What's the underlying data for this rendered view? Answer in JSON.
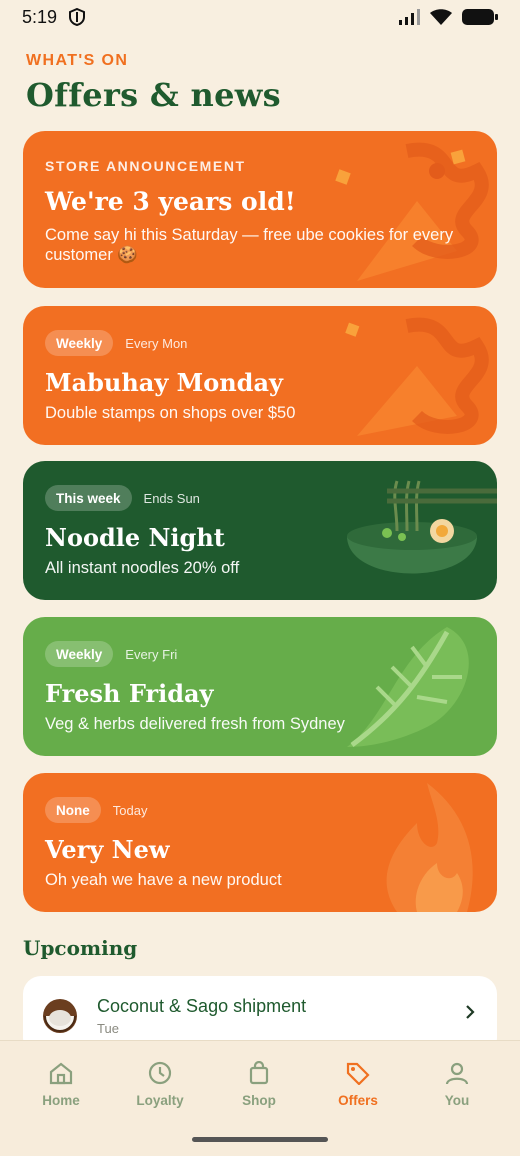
{
  "status": {
    "time": "5:19"
  },
  "header": {
    "eyebrow": "WHAT'S ON",
    "title": "Offers & news"
  },
  "announcement": {
    "kicker": "STORE ANNOUNCEMENT",
    "title": "We're 3 years old!",
    "desc": "Come say hi this Saturday — free ube cookies for every customer 🍪"
  },
  "offers": [
    {
      "badge": "Weekly",
      "meta": "Every Mon",
      "title": "Mabuhay Monday",
      "desc": "Double stamps on shops over $50"
    },
    {
      "badge": "This week",
      "meta": "Ends Sun",
      "title": "Noodle Night",
      "desc": "All instant noodles 20% off"
    },
    {
      "badge": "Weekly",
      "meta": "Every Fri",
      "title": "Fresh Friday",
      "desc": "Veg & herbs delivered fresh from Sydney"
    },
    {
      "badge": "None",
      "meta": "Today",
      "title": "Very New",
      "desc": "Oh yeah we have a new product"
    }
  ],
  "upcoming": {
    "section_title": "Upcoming",
    "items": [
      {
        "title": "Coconut & Sago shipment",
        "sub": "Tue"
      }
    ]
  },
  "nav": {
    "items": [
      {
        "label": "Home",
        "icon": "home-icon"
      },
      {
        "label": "Loyalty",
        "icon": "clock-icon"
      },
      {
        "label": "Shop",
        "icon": "bag-icon"
      },
      {
        "label": "Offers",
        "icon": "tag-icon",
        "active": true
      },
      {
        "label": "You",
        "icon": "person-icon"
      }
    ]
  },
  "colors": {
    "orange": "#f26f22",
    "dark_green": "#1f5a2e",
    "light_green": "#66ad4a",
    "background": "#f8efe0"
  }
}
